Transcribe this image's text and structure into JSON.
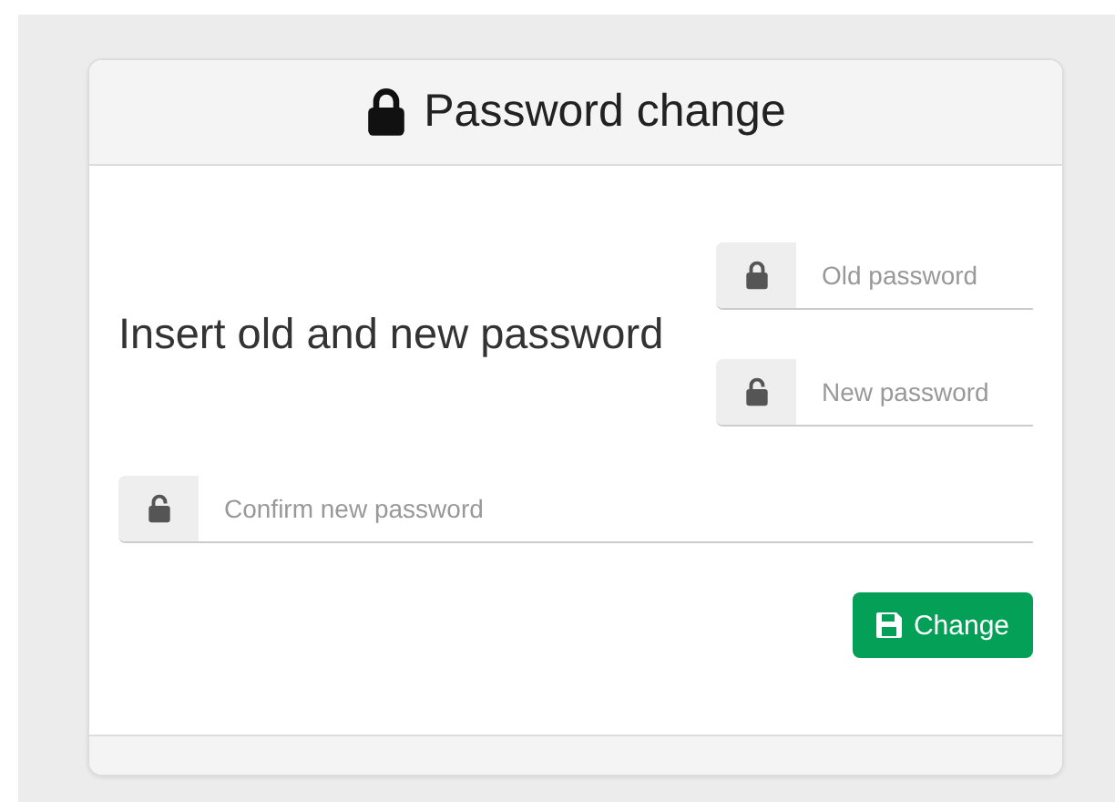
{
  "panel": {
    "title": "Password change",
    "prompt": "Insert old and new password",
    "fields": [
      {
        "placeholder": "Old password",
        "kind": "locked"
      },
      {
        "placeholder": "New password",
        "kind": "unlocked"
      },
      {
        "placeholder": "Confirm new password",
        "kind": "unlocked"
      }
    ],
    "button": "Change"
  }
}
